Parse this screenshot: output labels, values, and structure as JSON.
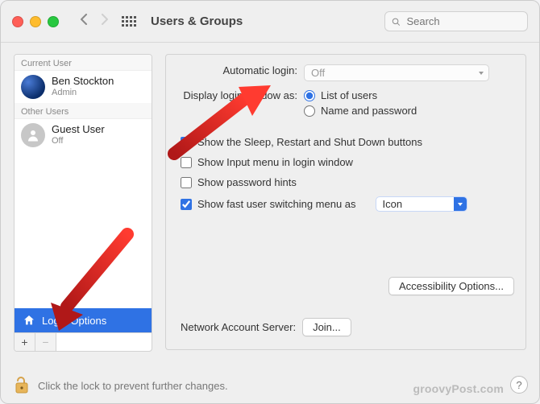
{
  "window": {
    "title": "Users & Groups",
    "search_placeholder": "Search"
  },
  "sidebar": {
    "current_label": "Current User",
    "other_label": "Other Users",
    "current_user": {
      "name": "Ben Stockton",
      "role": "Admin"
    },
    "other_user": {
      "name": "Guest User",
      "role": "Off"
    },
    "login_options_label": "Login Options",
    "add_label": "+",
    "remove_label": "−"
  },
  "settings": {
    "automatic_login_label": "Automatic login:",
    "automatic_login_value": "Off",
    "display_login_label": "Display login window as:",
    "radio_list": "List of users",
    "radio_namepw": "Name and password",
    "cb_sleep": "Show the Sleep, Restart and Shut Down buttons",
    "cb_input": "Show Input menu in login window",
    "cb_hints": "Show password hints",
    "cb_fastswitch": "Show fast user switching menu as",
    "fastswitch_value": "Icon",
    "accessibility_btn": "Accessibility Options...",
    "network_label": "Network Account Server:",
    "join_btn": "Join..."
  },
  "footer": {
    "lock_text": "Click the lock to prevent further changes."
  },
  "watermark": "groovyPost.com",
  "help": "?"
}
